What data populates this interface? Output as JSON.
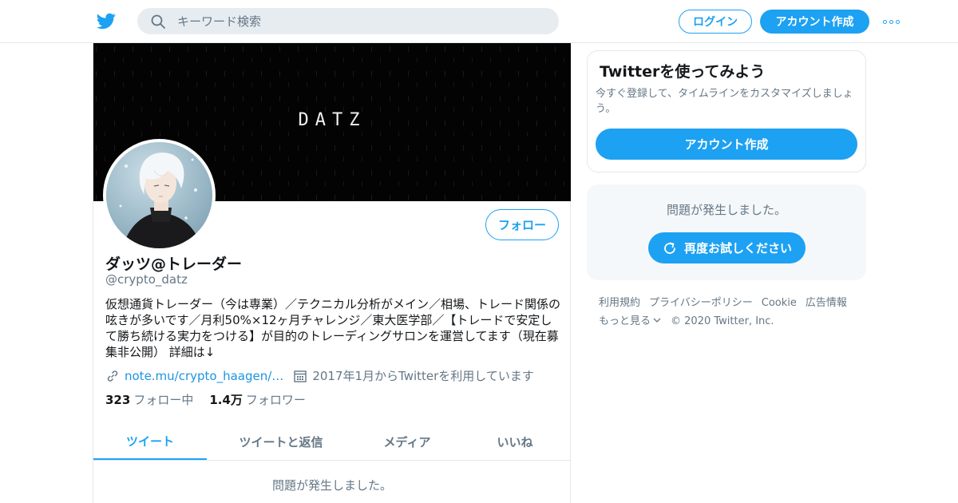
{
  "header": {
    "search_placeholder": "キーワード検索",
    "login_label": "ログイン",
    "signup_label": "アカウント作成"
  },
  "profile": {
    "banner_text": "DATZ",
    "name": "ダッツ@トレーダー",
    "handle": "@crypto_datz",
    "follow_label": "フォロー",
    "bio": "仮想通貨トレーダー（今は専業）／テクニカル分析がメイン／相場、トレード関係の呟きが多いです／月利50%×12ヶ月チャレンジ／東大医学部／【トレードで安定して勝ち続ける実力をつける】が目的のトレーディングサロンを運営してます（現在募集非公開） 詳細は↓",
    "link": "note.mu/crypto_haagen/…",
    "joined": "2017年1月からTwitterを利用しています",
    "following_count": "323",
    "following_label": "フォロー中",
    "followers_count": "1.4万",
    "followers_label": "フォロワー"
  },
  "tabs": [
    "ツイート",
    "ツイートと返信",
    "メディア",
    "いいね"
  ],
  "timeline_error": "問題が発生しました。",
  "sidebar": {
    "signup_card": {
      "title": "Twitterを使ってみよう",
      "description": "今すぐ登録して、タイムラインをカスタマイズしましょう。",
      "button": "アカウント作成"
    },
    "error_card": {
      "message": "問題が発生しました。",
      "retry_button": "再度お試しください"
    },
    "footer": {
      "links": [
        "利用規約",
        "プライバシーポリシー",
        "Cookie",
        "広告情報"
      ],
      "more": "もっと見る",
      "copyright": "© 2020 Twitter, Inc."
    }
  },
  "colors": {
    "accent": "#1da1f2",
    "secondary_text": "#657786",
    "border": "#e1e8ed"
  }
}
